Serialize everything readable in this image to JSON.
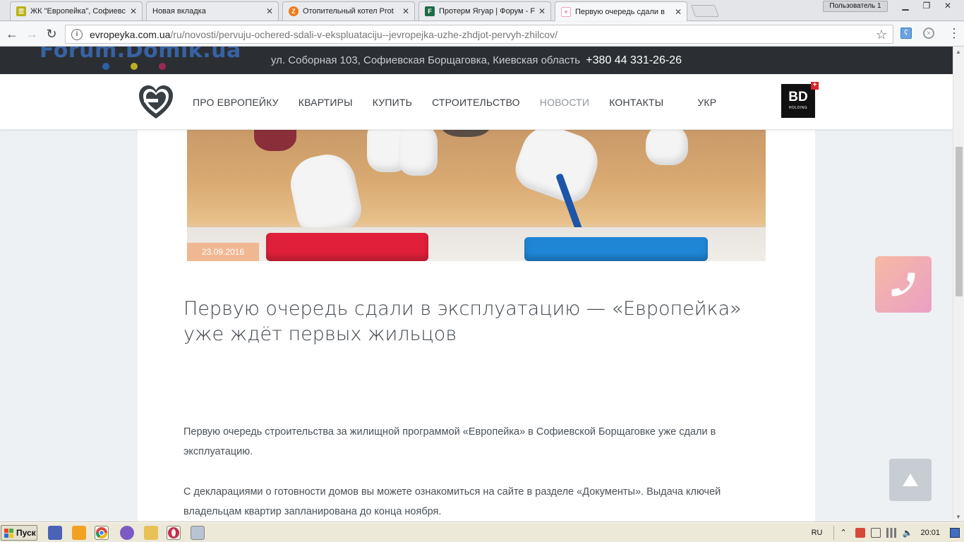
{
  "browser": {
    "tabs": [
      {
        "title": "ЖК \"Европейка\", Софиевс",
        "favicon_color": "#b9b21a",
        "favicon_glyph": "☰",
        "active": false
      },
      {
        "title": "Новая вкладка",
        "favicon_color": "",
        "favicon_glyph": "",
        "active": false
      },
      {
        "title": "Отопительный котел Prot",
        "favicon_color": "#f07a1a",
        "favicon_glyph": "Z",
        "active": false
      },
      {
        "title": "Протерм Ягуар | Форум - F",
        "favicon_color": "#1e6b48",
        "favicon_glyph": "F",
        "active": false
      },
      {
        "title": "Первую очередь сдали в",
        "favicon_color": "#e7a6c0",
        "favicon_glyph": "♥",
        "active": true
      }
    ],
    "user_label": "Пользователь 1",
    "address": {
      "host": "evropeyka.com.ua",
      "path": "/ru/novosti/pervuju-ochered-sdali-v-ekspluataciju--jevropejka-uzhe-zhdjot-pervyh-zhilcov/"
    }
  },
  "watermark": {
    "text": "Forum.Domik.ua",
    "dot_colors": [
      "#2f5fa8",
      "#b8b024",
      "#9b2a58"
    ]
  },
  "site": {
    "topbar": {
      "address": "ул. Соборная 103, Софиевская Борщаговка, Киевская область",
      "phone": "+380 44 331-26-26"
    },
    "nav": [
      {
        "label": "ПРО ЕВРОПЕЙКУ",
        "active": false
      },
      {
        "label": "КВАРТИРЫ",
        "active": false
      },
      {
        "label": "КУПИТЬ",
        "active": false
      },
      {
        "label": "СТРОИТЕЛЬСТВО",
        "active": false
      },
      {
        "label": "НОВОСТИ",
        "active": true
      },
      {
        "label": "КОНТАКТЫ",
        "active": false
      }
    ],
    "lang": "УКР",
    "partner_logo": {
      "main": "BD",
      "sub": "HOLDING",
      "badge": "+"
    }
  },
  "article": {
    "date": "23.09.2016",
    "title": "Первую очередь сдали в эксплуатацию — «Европейка» уже ждёт первых жильцов",
    "paragraphs": [
      "Первую очередь строительства за жилищной программой «Европейка» в Софиевской Борщаговке уже сдали в эксплуатацию.",
      "С декларациями о готовности домов вы можете ознакомиться на сайте в разделе «Документы». Выдача ключей владельцам квартир запланирована до конца ноября."
    ]
  },
  "colors": {
    "accent_peach": "#f0b892",
    "call_gradient_start": "#f6b9a4",
    "call_gradient_end": "#eaa0c4",
    "topbar_bg": "#2b2f33"
  },
  "taskbar": {
    "start_label": "Пуск",
    "lang": "RU",
    "clock": "20:01"
  }
}
